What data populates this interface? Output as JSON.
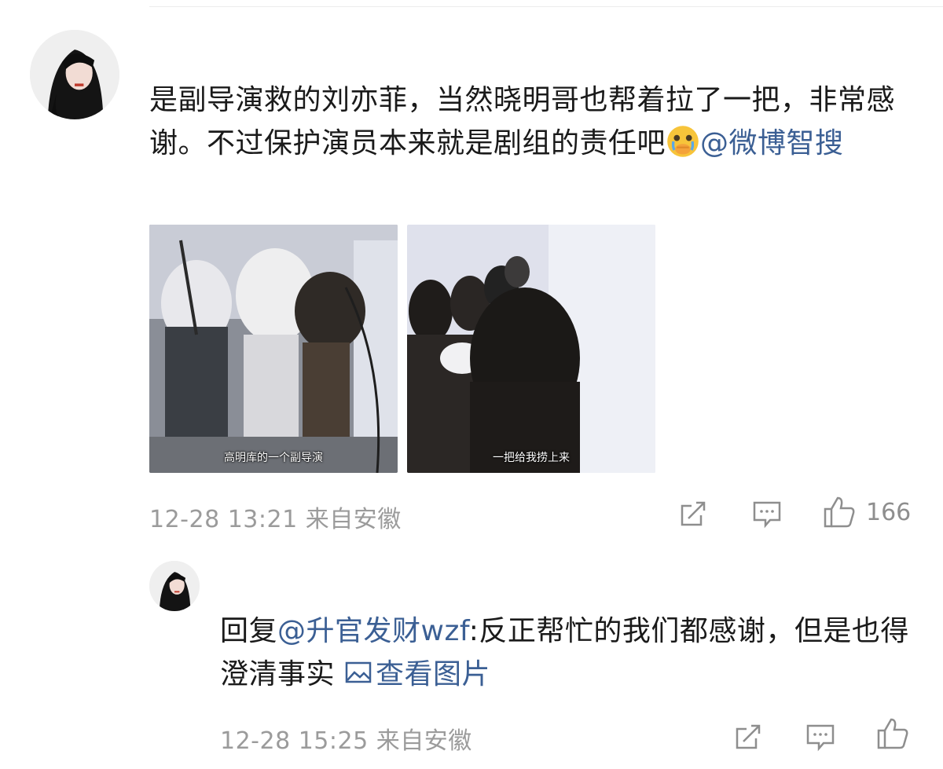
{
  "comment": {
    "text_main": "是副导演救的刘亦菲，当然晓明哥也帮着拉了一把，非常感谢。不过保护演员本来就是剧组的责任吧",
    "mention": "@微博智搜",
    "images": [
      {
        "caption": "高明库的一个副导演"
      },
      {
        "caption": "一把给我捞上来"
      }
    ],
    "timestamp": "12-28 13:21",
    "location": "来自安徽",
    "like_count": "166"
  },
  "reply": {
    "prefix": "回复",
    "mention": "@升官发财wzf",
    "text": ":反正帮忙的我们都感谢，但是也得澄清事实",
    "view_pic": "查看图片",
    "timestamp": "12-28 15:25",
    "location": "来自安徽"
  },
  "icons": {
    "share": "share-icon",
    "comment": "comment-icon",
    "like": "thumbs-up-icon",
    "emoji": "crying-emoji-icon",
    "picture": "image-icon"
  },
  "colors": {
    "link": "#3b5f94",
    "meta": "#9b9b9b"
  }
}
